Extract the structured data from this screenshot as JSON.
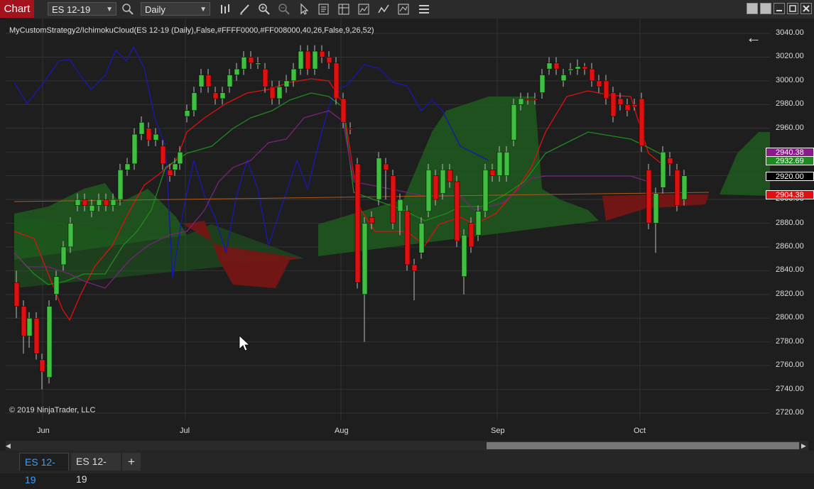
{
  "toolbar": {
    "title": "Chart",
    "instrument": "ES 12-19",
    "interval": "Daily",
    "icons": [
      "search-icon",
      "bar-type-icon",
      "draw-icon",
      "zoom-in-icon",
      "zoom-out-icon",
      "pointer-icon",
      "data-box-icon",
      "properties-icon",
      "strategies-icon",
      "indicators-icon",
      "templates-icon",
      "menu-icon"
    ],
    "window_buttons": [
      "tile-icon",
      "tile-icon",
      "minimize-icon",
      "maximize-icon",
      "close-icon"
    ]
  },
  "chart": {
    "indicator_label": "MyCustomStrategy2/IchimokuCloud(ES 12-19 (Daily),False,#FFFF0000,#FF008000,40,26,False,9,26,52)",
    "copyright": "© 2019 NinjaTrader, LLC",
    "back_arrow": "←"
  },
  "price_axis": {
    "ticks": [
      "3040.00",
      "3020.00",
      "3000.00",
      "2980.00",
      "2960.00",
      "2940.00",
      "2920.00",
      "2900.00",
      "2880.00",
      "2860.00",
      "2840.00",
      "2820.00",
      "2800.00",
      "2780.00",
      "2760.00",
      "2740.00",
      "2720.00"
    ],
    "markers": [
      {
        "text": "2940.38",
        "color": "#8b1a8b"
      },
      {
        "text": "2932.69",
        "color": "#1f8a1f"
      },
      {
        "text": "2920.00",
        "color": "#000000"
      },
      {
        "text": "2904.38",
        "color": "#e01010"
      }
    ]
  },
  "time_axis": {
    "labels": [
      "Jun",
      "Jul",
      "Aug",
      "Sep",
      "Oct"
    ]
  },
  "tabs": [
    {
      "label": "ES 12-19",
      "active": true
    },
    {
      "label": "ES 12-19",
      "active": false
    },
    {
      "label": "+",
      "active": false
    }
  ],
  "colors": {
    "bull": "#3fbf3f",
    "bear": "#e01010",
    "cloud_bull": "#1e5b1e",
    "cloud_bear": "#7a1414",
    "chikou": "#1a1aa0",
    "tenkan": "#e01010",
    "kijun": "#1f8a1f",
    "purple": "#7a237a"
  }
}
